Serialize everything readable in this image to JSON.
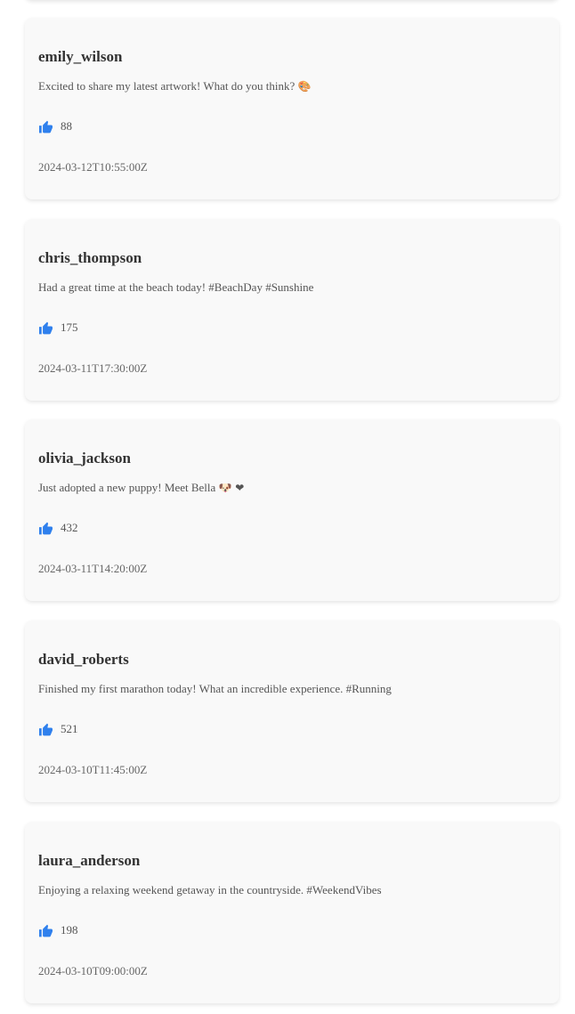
{
  "colors": {
    "card_background": "#f9f9f9",
    "like_icon": "#2f80ed",
    "username_text": "#333333",
    "body_text": "#555555"
  },
  "icons": {
    "like": "thumbs-up-icon"
  },
  "posts": [
    {
      "username": "emily_wilson",
      "content": "Excited to share my latest artwork! What do you think?",
      "emoji": "🎨",
      "likes": "88",
      "timestamp": "2024-03-12T10:55:00Z"
    },
    {
      "username": "chris_thompson",
      "content": "Had a great time at the beach today! #BeachDay #Sunshine",
      "emoji": "",
      "likes": "175",
      "timestamp": "2024-03-11T17:30:00Z"
    },
    {
      "username": "olivia_jackson",
      "content": "Just adopted a new puppy! Meet Bella",
      "emoji": "🐶 ❤",
      "likes": "432",
      "timestamp": "2024-03-11T14:20:00Z"
    },
    {
      "username": "david_roberts",
      "content": "Finished my first marathon today! What an incredible experience. #Running",
      "emoji": "",
      "likes": "521",
      "timestamp": "2024-03-10T11:45:00Z"
    },
    {
      "username": "laura_anderson",
      "content": "Enjoying a relaxing weekend getaway in the countryside. #WeekendVibes",
      "emoji": "",
      "likes": "198",
      "timestamp": "2024-03-10T09:00:00Z"
    }
  ]
}
